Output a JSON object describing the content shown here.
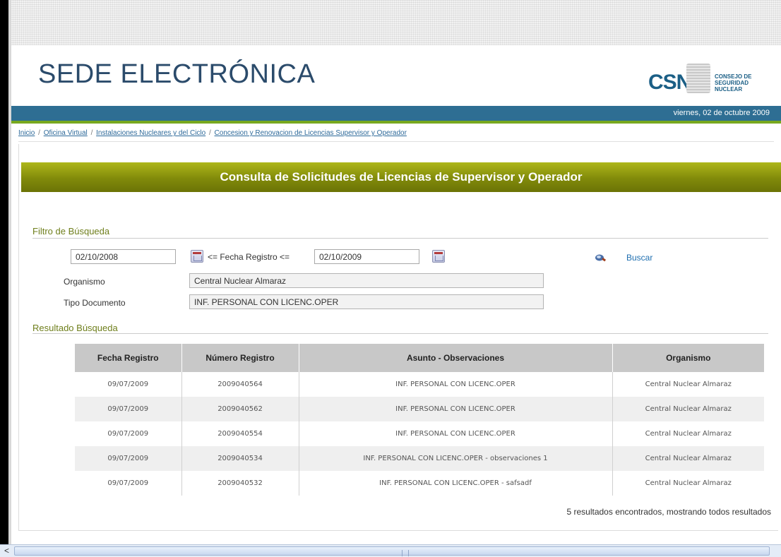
{
  "header": {
    "site_title": "SEDE ELECTRÓNICA",
    "logo": {
      "abbr": "CSN",
      "line1": "CONSEJO DE",
      "line2": "SEGURIDAD NUCLEAR"
    },
    "date": "viernes, 02 de octubre 2009"
  },
  "breadcrumb": [
    "Inicio",
    "Oficina Virtual",
    "Instalaciones Nucleares y del Ciclo",
    "Concesion y Renovacion de Licencias Supervisor y Operador"
  ],
  "breadcrumb_separator": "/",
  "panel": {
    "title": "Consulta de Solicitudes de Licencias de Supervisor y Operador"
  },
  "filter": {
    "section_label": "Filtro de Búsqueda",
    "date_from": "02/10/2008",
    "date_label": "<= Fecha Registro <=",
    "date_to": "02/10/2009",
    "search_label": "Buscar",
    "organismo_label": "Organismo",
    "organismo_value": "Central Nuclear Almaraz",
    "tipo_label": "Tipo Documento",
    "tipo_value": "INF. PERSONAL CON LICENC.OPER"
  },
  "results": {
    "section_label": "Resultado Búsqueda",
    "columns": [
      "Fecha Registro",
      "Número Registro",
      "Asunto - Observaciones",
      "Organismo"
    ],
    "rows": [
      [
        "09/07/2009",
        "2009040564",
        "INF. PERSONAL CON LICENC.OPER",
        "Central Nuclear Almaraz"
      ],
      [
        "09/07/2009",
        "2009040562",
        "INF. PERSONAL CON LICENC.OPER",
        "Central Nuclear Almaraz"
      ],
      [
        "09/07/2009",
        "2009040554",
        "INF. PERSONAL CON LICENC.OPER",
        "Central Nuclear Almaraz"
      ],
      [
        "09/07/2009",
        "2009040534",
        "INF. PERSONAL CON LICENC.OPER - observaciones 1",
        "Central Nuclear Almaraz"
      ],
      [
        "09/07/2009",
        "2009040532",
        "INF. PERSONAL CON LICENC.OPER - safsadf",
        "Central Nuclear Almaraz"
      ]
    ],
    "summary": "5 resultados encontrados, mostrando todos resultados"
  },
  "scrollbar": {
    "left_arrow": "<"
  },
  "colors": {
    "title_blue": "#2b4b6b",
    "bar_blue": "#2e6e93",
    "accent_green": "#78a81f",
    "olive": "#818a0a",
    "section_green": "#6f7f1c",
    "link_blue": "#2e6a9a"
  }
}
